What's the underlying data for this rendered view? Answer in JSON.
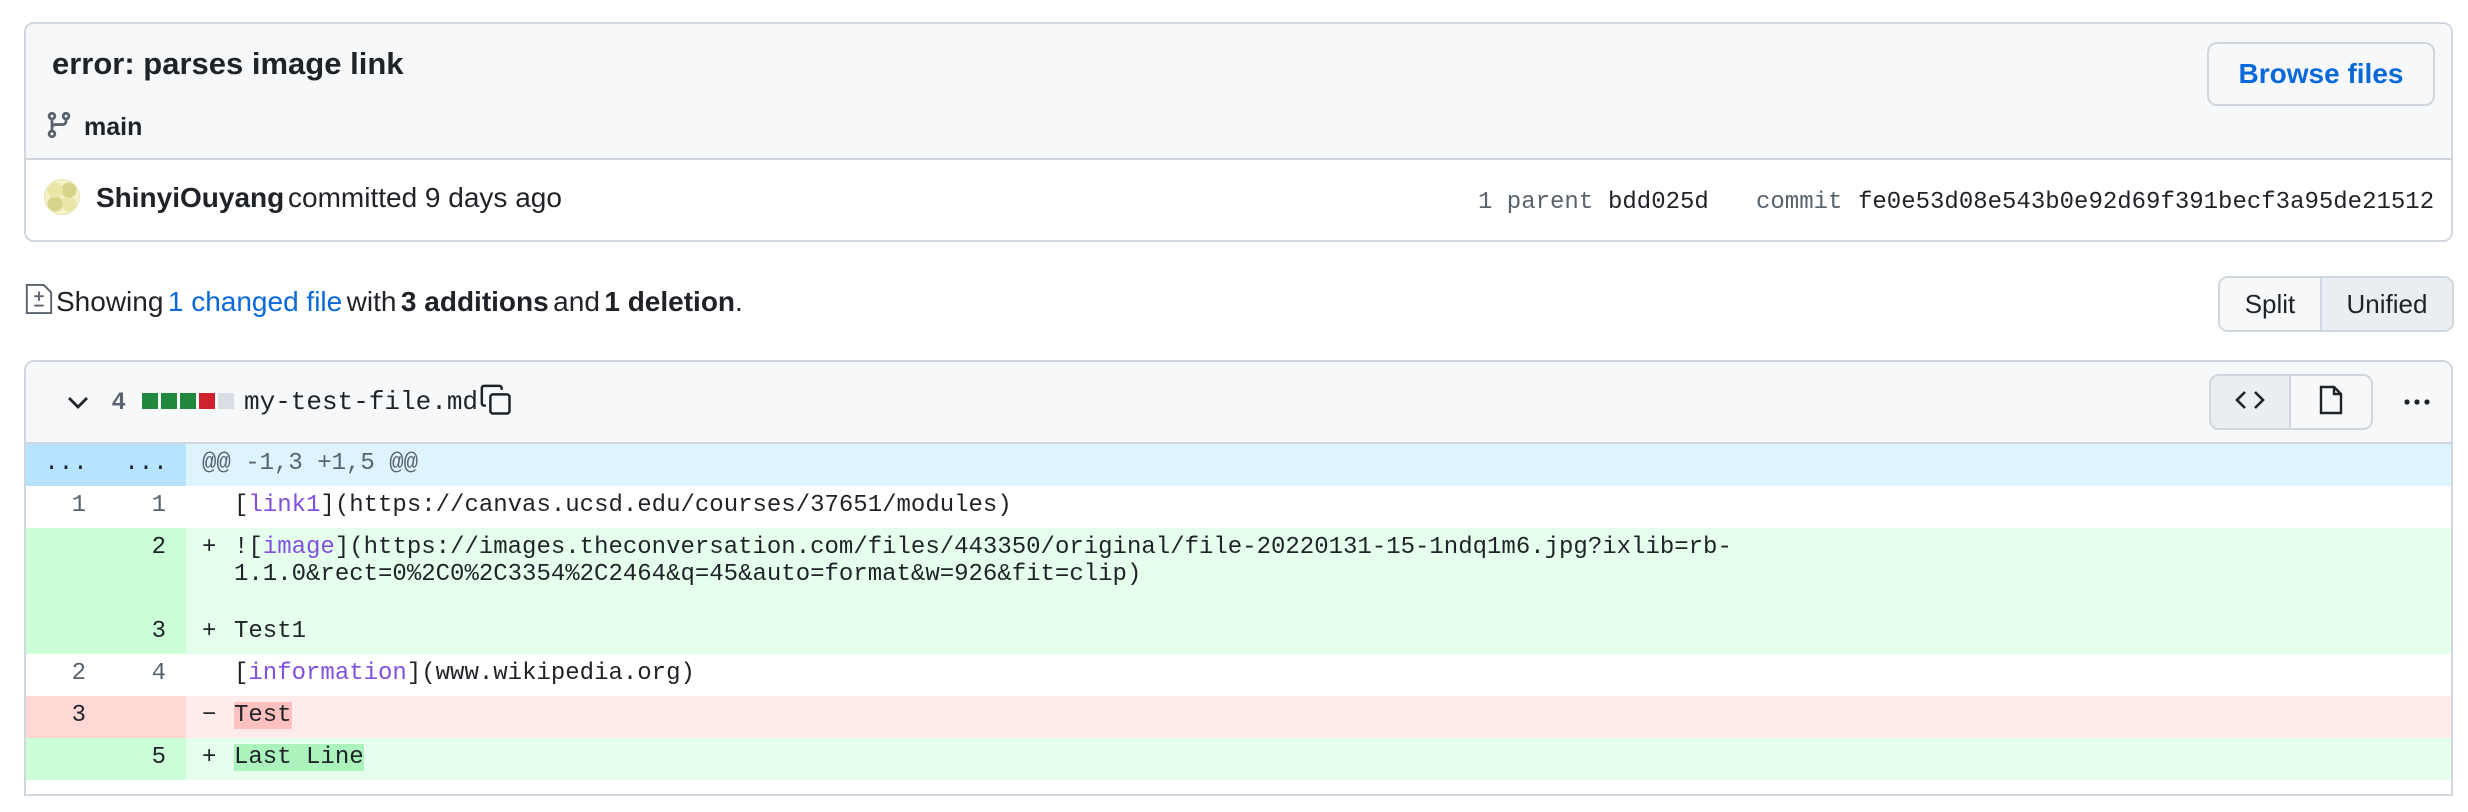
{
  "commit": {
    "title": "error: parses image link",
    "branch": "main",
    "browse_label": "Browse files",
    "author": "ShinyiOuyang",
    "committed_text": "committed 9 days ago",
    "parent_label": "1 parent",
    "parent_sha": "bdd025d",
    "commit_label": "commit",
    "commit_sha": "fe0e53d08e543b0e92d69f391becf3a95de21512"
  },
  "summary": {
    "prefix": "Showing",
    "changed_link": "1 changed file",
    "with": "with",
    "additions": "3 additions",
    "and": "and",
    "deletions": "1 deletion",
    "suffix": "."
  },
  "view_toggle": {
    "split": "Split",
    "unified": "Unified"
  },
  "file": {
    "change_count": "4",
    "name": "my-test-file.md",
    "diffstat": [
      "add",
      "add",
      "add",
      "del",
      "neutral"
    ]
  },
  "diff": {
    "hunk_old": "...",
    "hunk_new": "...",
    "hunk_header": "@@ -1,3 +1,5 @@",
    "lines": [
      {
        "type": "ctx",
        "old": "1",
        "new": "1",
        "marker": " ",
        "pre": "[",
        "link": "link1",
        "post": "](https://canvas.ucsd.edu/courses/37651/modules)"
      },
      {
        "type": "add",
        "old": "",
        "new": "2",
        "marker": "+",
        "pre": "![",
        "link": "image",
        "post": "](https://images.theconversation.com/files/443350/original/file-20220131-15-1ndq1m6.jpg?ixlib=rb-",
        "cont": "1.1.0&rect=0%2C0%2C3354%2C2464&q=45&auto=format&w=926&fit=clip)"
      },
      {
        "type": "add",
        "old": "",
        "new": "3",
        "marker": "+",
        "text": "Test1"
      },
      {
        "type": "ctx",
        "old": "2",
        "new": "4",
        "marker": " ",
        "pre": "[",
        "link": "information",
        "post": "](www.wikipedia.org)"
      },
      {
        "type": "del",
        "old": "3",
        "new": "",
        "marker": "−",
        "text": "Test"
      },
      {
        "type": "add",
        "old": "",
        "new": "5",
        "marker": "+",
        "text": "Last Line"
      }
    ]
  }
}
